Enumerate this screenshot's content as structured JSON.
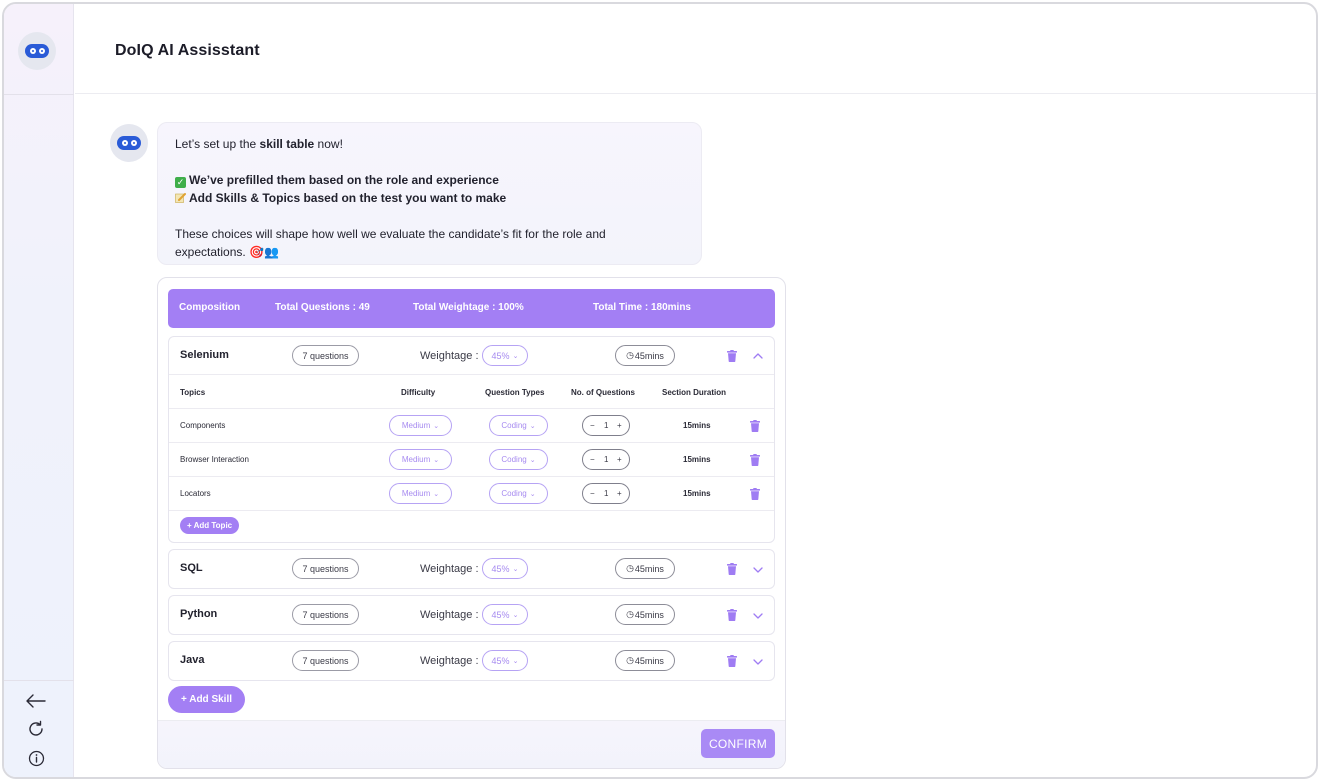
{
  "app": {
    "title": "DoIQ AI Assisstant"
  },
  "sidebar": {
    "icons": [
      "bot-logo-icon",
      "back-arrow-icon",
      "refresh-icon",
      "info-icon"
    ]
  },
  "message": {
    "intro_pre": "Let’s set up the ",
    "intro_bold": "skill table",
    "intro_post": "  now!",
    "bullet1": "We’ve prefilled them based on the role and experience",
    "bullet2": "Add Skills & Topics based on the test you want to make",
    "para_line1": "These choices will shape how well we evaluate the candidate’s fit for the role and",
    "para_line2": "expectations. 🎯👥"
  },
  "composition": {
    "label": "Composition",
    "total_questions": "Total Questions : 49",
    "total_weightage": "Total Weightage : 100%",
    "total_time": "Total Time : 180mins"
  },
  "columns": {
    "topics": "Topics",
    "difficulty": "Difficulty",
    "question_types": "Question Types",
    "num_questions": "No. of Questions",
    "section_duration": "Section Duration"
  },
  "weightage_label": "Weightage :",
  "skills": [
    {
      "name": "Selenium",
      "questions": "7 questions",
      "weight": "45%",
      "time": "45mins",
      "expanded": true,
      "topics": [
        {
          "name": "Components",
          "difficulty": "Medium",
          "type": "Coding",
          "count": "1",
          "duration": "15mins"
        },
        {
          "name": "Browser Interaction",
          "difficulty": "Medium",
          "type": "Coding",
          "count": "1",
          "duration": "15mins"
        },
        {
          "name": "Locators",
          "difficulty": "Medium",
          "type": "Coding",
          "count": "1",
          "duration": "15mins"
        }
      ]
    },
    {
      "name": "SQL",
      "questions": "7 questions",
      "weight": "45%",
      "time": "45mins",
      "expanded": false
    },
    {
      "name": "Python",
      "questions": "7 questions",
      "weight": "45%",
      "time": "45mins",
      "expanded": false
    },
    {
      "name": "Java",
      "questions": "7 questions",
      "weight": "45%",
      "time": "45mins",
      "expanded": false
    }
  ],
  "buttons": {
    "add_topic": "+ Add Topic",
    "add_skill": "+ Add Skill",
    "confirm": "CONFIRM",
    "minus": "−",
    "plus": "+",
    "caret": "⌄",
    "clock": "◷"
  },
  "colors": {
    "accent": "#a37ff4",
    "confirm": "#a98af5",
    "trash": "#9f7cf3",
    "bot": "#2a5bd7"
  }
}
